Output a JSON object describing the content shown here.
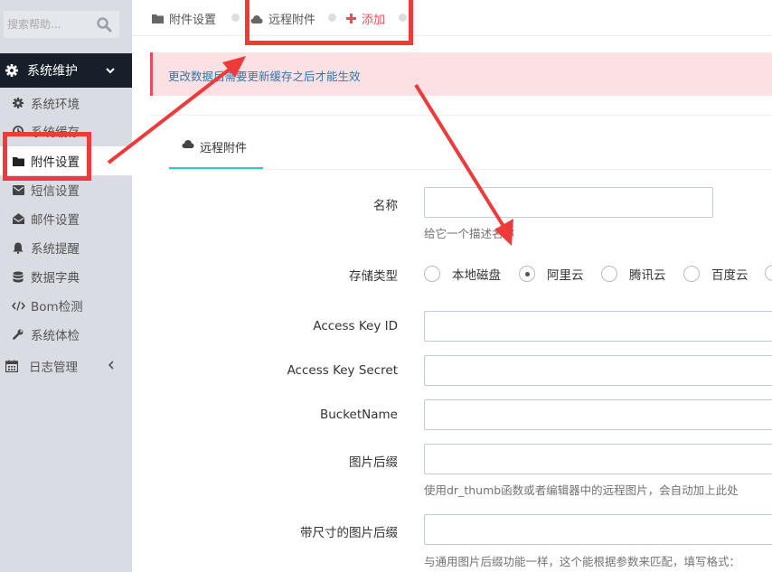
{
  "sidebar": {
    "search": {
      "placeholder": "搜索帮助..."
    },
    "section": {
      "label": "系统维护"
    },
    "items": [
      {
        "label": "系统环境",
        "icon": "gear-icon"
      },
      {
        "label": "系统缓存",
        "icon": "clock-icon"
      },
      {
        "label": "附件设置",
        "icon": "folder-icon",
        "active": true
      },
      {
        "label": "短信设置",
        "icon": "envelope-icon"
      },
      {
        "label": "邮件设置",
        "icon": "envelope-open-icon"
      },
      {
        "label": "系统提醒",
        "icon": "bell-icon"
      },
      {
        "label": "数据字典",
        "icon": "database-icon"
      },
      {
        "label": "Bom检测",
        "icon": "code-icon"
      },
      {
        "label": "系统体检",
        "icon": "wrench-icon"
      }
    ],
    "log": {
      "label": "日志管理",
      "icon": "calendar-icon"
    }
  },
  "breadcrumb": {
    "items": [
      {
        "label": "附件设置",
        "icon": "folder-icon"
      },
      {
        "label": "远程附件",
        "icon": "cloud-icon"
      },
      {
        "label": "添加",
        "icon": "plus-icon"
      }
    ]
  },
  "alert": {
    "text": "更改数据后需要更新缓存之后才能生效"
  },
  "tab": {
    "label": "远程附件"
  },
  "form": {
    "name": {
      "label": "名称",
      "value": "",
      "help": "给它一个描述名称"
    },
    "storage": {
      "label": "存储类型",
      "options": [
        "本地磁盘",
        "阿里云",
        "腾讯云",
        "百度云"
      ],
      "selected": "阿里云"
    },
    "access_key_id": {
      "label": "Access Key ID",
      "value": ""
    },
    "access_key_secret": {
      "label": "Access Key Secret",
      "value": ""
    },
    "bucket": {
      "label": "BucketName",
      "value": ""
    },
    "img_suffix": {
      "label": "图片后缀",
      "value": "",
      "help": "使用dr_thumb函数或者编辑器中的远程图片，会自动加上此处"
    },
    "sized_img_suffix": {
      "label": "带尺寸的图片后缀",
      "value": "",
      "help": "与通用图片后缀功能一样，这个能根据参数来匹配，填写格式："
    }
  },
  "colors": {
    "sidebar_bg": "#d9dde3",
    "sidebar_head_bg": "#17202a",
    "accent": "#36c6d3",
    "danger": "#e7505a",
    "annotation": "#f03a3a"
  }
}
